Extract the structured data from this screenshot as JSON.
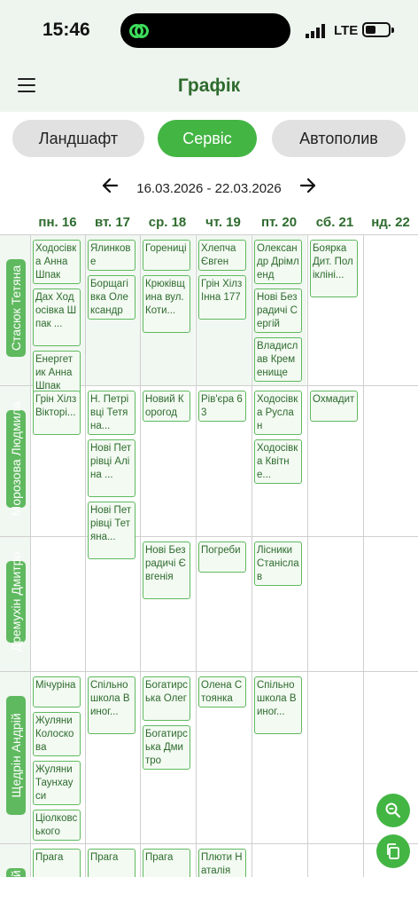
{
  "status": {
    "time": "15:46",
    "network": "LTE"
  },
  "header": {
    "title": "Графік"
  },
  "tabs": [
    {
      "label": "Ландшафт",
      "active": false
    },
    {
      "label": "Сервіс",
      "active": true
    },
    {
      "label": "Автополив",
      "active": false
    }
  ],
  "week": {
    "range": "16.03.2026 - 22.03.2026"
  },
  "days": [
    "пн. 16",
    "вт. 17",
    "ср. 18",
    "чт. 19",
    "пт. 20",
    "сб. 21",
    "нд. 22"
  ],
  "colors": {
    "accent": "#43b543",
    "title": "#2e6b2e",
    "header_bg": "#eef5ee"
  },
  "workers": [
    {
      "name": "Стасюк Тетяна",
      "cells": [
        [
          "Ходосівка Анна Шпак",
          "Дах Ходосівка Шпак ...",
          "Енергетик Анна Шпак"
        ],
        [
          "Ялинкове",
          "Борщагівка Олександр"
        ],
        [
          "Горениці",
          "Крюківщина вул.Коти..."
        ],
        [
          "Хлепча Євген",
          "Грін Хілз Інна 177"
        ],
        [
          "Олександр Дрімленд",
          "Нові Безрадичі Сергій",
          "Владислав Кременище"
        ],
        [
          "Боярка Дит. Полікліні..."
        ],
        []
      ]
    },
    {
      "name": "Морозова Людмила",
      "cells": [
        [
          "Грін Хілз Вікторі..."
        ],
        [
          "Н. Петрівці Тетяна...",
          "Нові Петрівці Аліна ...",
          "Нові Петрівці Тетяна..."
        ],
        [
          "Новий Корогод"
        ],
        [
          "Рів'єра 63"
        ],
        [
          "Ходосівка Руслан",
          "Ходосівка Квітне..."
        ],
        [
          "Охмадит"
        ],
        []
      ]
    },
    {
      "name": "Дремухін Дмитро",
      "cells": [
        [],
        [],
        [
          "Нові Безрадичі Євгенія"
        ],
        [
          "Погреби"
        ],
        [
          "Лісники Станіслав"
        ],
        [],
        []
      ]
    },
    {
      "name": "Щедрін Андрій",
      "cells": [
        [
          "Мічуріна",
          "Жуляни Колосковa",
          "Жуляни Таунхауси",
          "Ціолковського"
        ],
        [
          "Спільно школа Виног..."
        ],
        [
          "Богатирська Олег",
          "Богатирська Дмитро"
        ],
        [
          "Олена Стоянка"
        ],
        [
          "Спільно школа Виног..."
        ],
        [],
        []
      ]
    },
    {
      "name": "...ргій",
      "cells": [
        [
          "Прага"
        ],
        [
          "Прага",
          ""
        ],
        [
          "Прага"
        ],
        [
          "Плюти Наталія"
        ],
        [],
        [],
        []
      ]
    }
  ]
}
